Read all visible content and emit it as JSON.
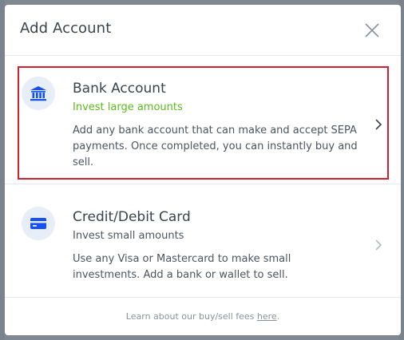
{
  "modal": {
    "title": "Add Account"
  },
  "options": [
    {
      "title": "Bank Account",
      "subtitle": "Invest large amounts",
      "description": "Add any bank account that can make and accept SEPA payments. Once completed, you can instantly buy and sell.",
      "icon": "bank-icon",
      "subtitle_color": "#5bbb1a"
    },
    {
      "title": "Credit/Debit Card",
      "subtitle": "Invest small amounts",
      "description": "Use any Visa or Mastercard to make small investments. Add a bank or wallet to sell.",
      "icon": "credit-card-icon",
      "subtitle_color": "#4c555f"
    }
  ],
  "footer": {
    "text_before": "Learn about our buy/sell fees ",
    "link_text": "here",
    "text_after": "."
  },
  "colors": {
    "accent": "#1652f0",
    "highlight": "#d32030",
    "icon_bg": "#e7eef8"
  }
}
